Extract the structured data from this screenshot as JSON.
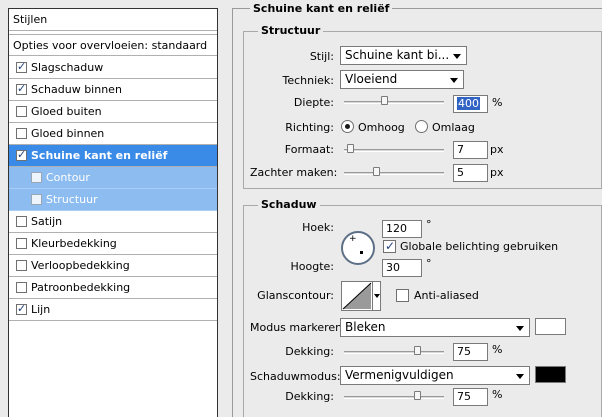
{
  "left_panel": {
    "title": "Stijlen",
    "blend_options": "Opties voor overvloeien: standaard",
    "items": [
      {
        "label": "Slagschaduw",
        "checked": true
      },
      {
        "label": "Schaduw binnen",
        "checked": true
      },
      {
        "label": "Gloed buiten",
        "checked": false
      },
      {
        "label": "Gloed binnen",
        "checked": false
      },
      {
        "label": "Schuine kant en reliëf",
        "checked": true,
        "active": true
      },
      {
        "label": "Contour",
        "checked": false,
        "sub": true
      },
      {
        "label": "Structuur",
        "checked": false,
        "sub": true
      },
      {
        "label": "Satijn",
        "checked": false
      },
      {
        "label": "Kleurbedekking",
        "checked": false
      },
      {
        "label": "Verloopbedekking",
        "checked": false
      },
      {
        "label": "Patroonbedekking",
        "checked": false
      },
      {
        "label": "Lijn",
        "checked": true
      }
    ]
  },
  "main_title": "Schuine kant en reliëf",
  "structure": {
    "title": "Structuur",
    "style_label": "Stijl:",
    "style_value": "Schuine kant bi...",
    "technique_label": "Techniek:",
    "technique_value": "Vloeiend",
    "depth_label": "Diepte:",
    "depth_value": "400",
    "depth_unit": "%",
    "depth_slider_fraction": 0.4,
    "direction_label": "Richting:",
    "direction_up": "Omhoog",
    "direction_down": "Omlaag",
    "direction_selected": "up",
    "size_label": "Formaat:",
    "size_value": "7",
    "size_unit": "px",
    "size_slider_fraction": 0.03,
    "soften_label": "Zachter maken:",
    "soften_value": "5",
    "soften_unit": "px",
    "soften_slider_fraction": 0.31
  },
  "shading": {
    "title": "Schaduw",
    "angle_label": "Hoek:",
    "angle_value": "120",
    "angle_unit": "°",
    "global_light_label": "Globale belichting gebruiken",
    "global_light_checked": true,
    "altitude_label": "Hoogte:",
    "altitude_value": "30",
    "altitude_unit": "°",
    "gloss_label": "Glanscontour:",
    "antialias_label": "Anti-aliased",
    "antialias_checked": false,
    "highlight_mode_label": "Modus markeren:",
    "highlight_mode_value": "Bleken",
    "highlight_color": "#ffffff",
    "highlight_opacity_label": "Dekking:",
    "highlight_opacity_value": "75",
    "highlight_opacity_unit": "%",
    "highlight_opacity_fraction": 0.75,
    "shadow_mode_label": "Schaduwmodus:",
    "shadow_mode_value": "Vermenigvuldigen",
    "shadow_color": "#000000",
    "shadow_opacity_label": "Dekking:",
    "shadow_opacity_value": "75",
    "shadow_opacity_unit": "%",
    "shadow_opacity_fraction": 0.75
  },
  "colors": {
    "active_row": "#3a8be8",
    "sub_row": "#8cbcf0",
    "panel_bg": "#ebebeb"
  }
}
